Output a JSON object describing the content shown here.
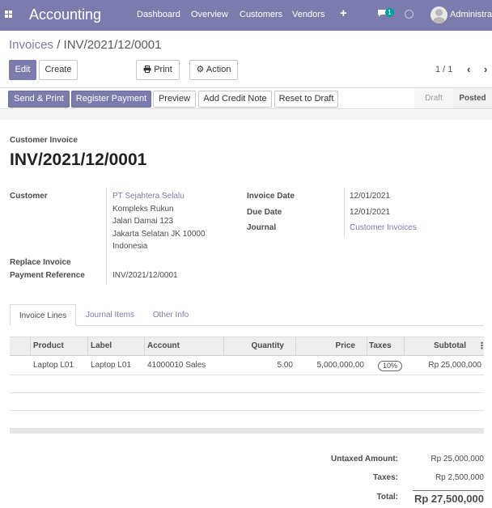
{
  "topnav": {
    "app_title": "Accounting",
    "menu": [
      "Dashboard",
      "Overview",
      "Customers",
      "Vendors"
    ],
    "plus_glyph": "+",
    "message_count": "1",
    "user_name": "Administrator",
    "icons": [
      "apps-grid-icon",
      "plus-icon",
      "chat-icon",
      "clock-icon",
      "avatar"
    ]
  },
  "breadcrumb": {
    "parent": "Invoices",
    "separator": " / ",
    "current": "INV/2021/12/0001"
  },
  "control": {
    "edit_label": "Edit",
    "create_label": "Create",
    "print_label": "Print",
    "action_label": "Action",
    "pager_text": "1 / 1"
  },
  "statusbar": {
    "buttons": [
      "Send & Print",
      "Register Payment",
      "Preview",
      "Add Credit Note",
      "Reset to Draft"
    ],
    "stages": [
      "Draft",
      "Posted"
    ],
    "active_stage": "Posted"
  },
  "invoice": {
    "type_label": "Customer Invoice",
    "name": "INV/2021/12/0001",
    "customer_label": "Customer",
    "customer_name": "PT Sejahtera Selalu",
    "customer_address": [
      "Kompleks Rukun",
      "Jalan Damai 123",
      "Jakarta Selatan JK 10000",
      "Indonesia"
    ],
    "replace_invoice_label": "Replace Invoice",
    "payment_reference_label": "Payment Reference",
    "payment_reference": "INV/2021/12/0001",
    "invoice_date_label": "Invoice Date",
    "invoice_date": "12/01/2021",
    "due_date_label": "Due Date",
    "due_date": "12/01/2021",
    "journal_label": "Journal",
    "journal": "Customer Invoices"
  },
  "tabs": [
    "Invoice Lines",
    "Journal Items",
    "Other Info"
  ],
  "lines": {
    "headers": [
      "Product",
      "Label",
      "Account",
      "Quantity",
      "Price",
      "Taxes",
      "Subtotal"
    ],
    "rows": [
      {
        "product": "Laptop L01",
        "label": "Laptop L01",
        "account": "41000010 Sales",
        "quantity": "5.00",
        "price": "5,000,000.00",
        "taxes": "10%",
        "subtotal": "Rp 25,000,000"
      }
    ]
  },
  "totals": {
    "untaxed_label": "Untaxed Amount:",
    "untaxed": "Rp 25,000,000",
    "taxes_label": "Taxes:",
    "taxes": "Rp 2,500,000",
    "total_label": "Total:",
    "total": "Rp 27,500,000"
  },
  "colors": {
    "brand": "#7c7bad",
    "badge": "#00a09d"
  }
}
